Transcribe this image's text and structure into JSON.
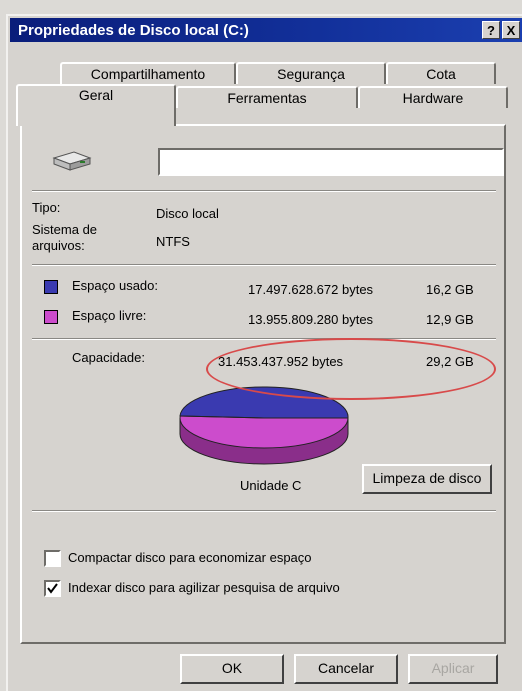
{
  "window": {
    "title": "Propriedades de Disco local (C:)",
    "help_btn": "?",
    "close_btn": "X"
  },
  "tabs": {
    "row1": [
      "Compartilhamento",
      "Segurança",
      "Cota"
    ],
    "row2": [
      "Geral",
      "Ferramentas",
      "Hardware"
    ]
  },
  "info": {
    "tipo_label": "Tipo:",
    "tipo_value": "Disco local",
    "sistema_label_1": "Sistema de",
    "sistema_label_2": "arquivos:",
    "sistema_value": "NTFS"
  },
  "space": {
    "used_label": "Espaço usado:",
    "used_bytes": "17.497.628.672 bytes",
    "used_gb": "16,2 GB",
    "free_label": "Espaço livre:",
    "free_bytes": "13.955.809.280 bytes",
    "free_gb": "12,9 GB",
    "cap_label": "Capacidade:",
    "cap_bytes": "31.453.437.952 bytes",
    "cap_gb": "29,2 GB"
  },
  "chart": {
    "label": "Unidade C",
    "cleanup_button": "Limpeza de disco",
    "used_color": "#3a3ab0",
    "free_color": "#cc4ccc"
  },
  "options": {
    "compress": {
      "label": "Compactar disco para economizar espaço",
      "checked": false
    },
    "index": {
      "label": "Indexar disco para agilizar pesquisa de arquivo",
      "checked": true
    }
  },
  "buttons": {
    "ok": "OK",
    "cancel": "Cancelar",
    "apply": "Aplicar"
  }
}
